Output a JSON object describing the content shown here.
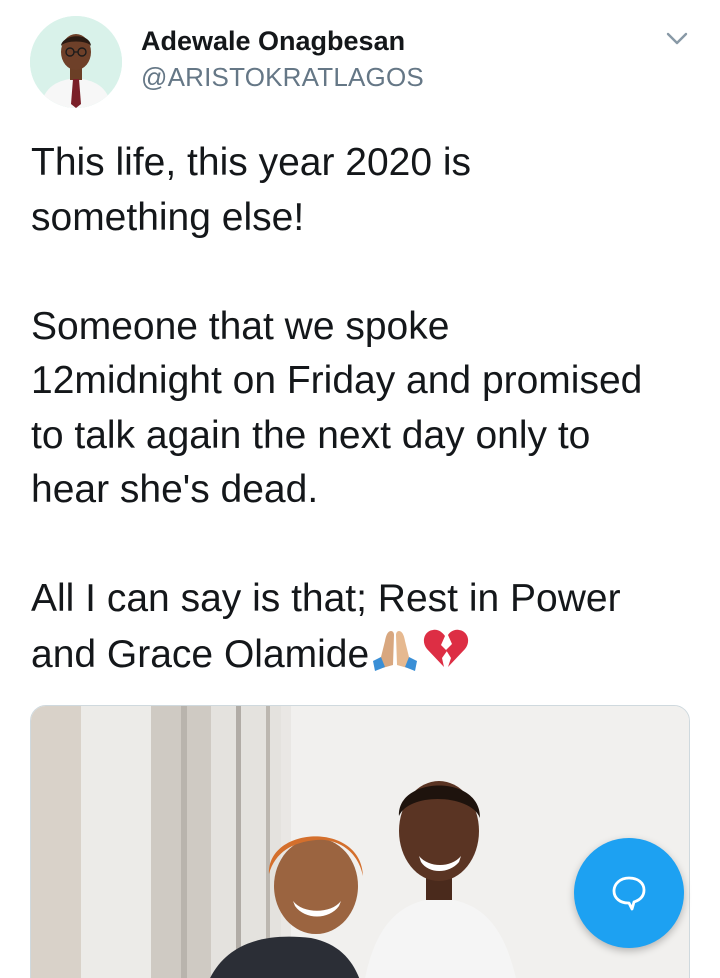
{
  "author": {
    "display_name": "Adewale Onagbesan",
    "handle": "@ARISTOKRATLAGOS",
    "avatar_icon": "profile-photo"
  },
  "tweet": {
    "paragraphs": [
      {
        "lines": [
          "This life, this year 2020 is",
          "something else!"
        ]
      },
      {
        "lines": [
          "Someone that we spoke",
          "12midnight on Friday and promised",
          "to talk again the next day only to",
          "hear she's dead."
        ]
      },
      {
        "lines": [
          "All I can say is that; Rest in Power",
          "and Grace Olamide"
        ]
      }
    ],
    "emojis": [
      "folded-hands-icon",
      "broken-heart-icon"
    ]
  },
  "icons": {
    "menu": "chevron-down-icon",
    "compose": "compose-tweet-icon"
  },
  "colors": {
    "accent": "#1da1f2",
    "text": "#14171a",
    "secondary": "#657786",
    "broken_heart": "#dd2e44"
  }
}
